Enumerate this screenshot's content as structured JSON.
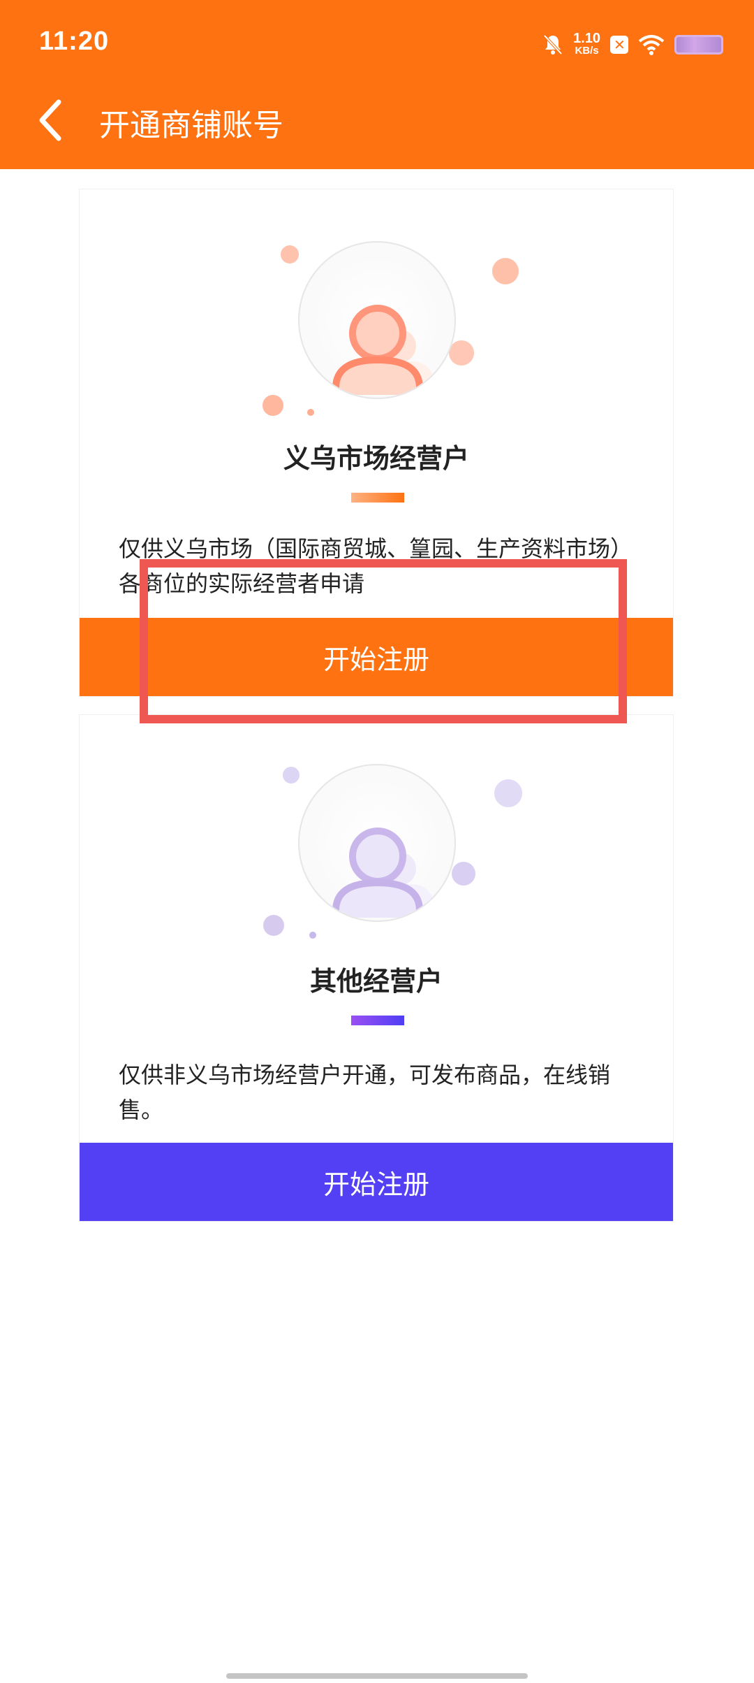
{
  "status_bar": {
    "time": "11:20",
    "net_speed_value": "1.10",
    "net_speed_unit": "KB/s",
    "icons": [
      "bell-off-icon",
      "x-icon",
      "wifi-icon",
      "battery-icon"
    ]
  },
  "header": {
    "title": "开通商铺账号",
    "back_icon": "chevron-left-icon"
  },
  "cards": [
    {
      "title": "义乌市场经营户",
      "description": "仅供义乌市场（国际商贸城、篁园、生产资料市场）各商位的实际经营者申请",
      "button_label": "开始注册",
      "accent_color": "#ff7212"
    },
    {
      "title": "其他经营户",
      "description": "仅供非义乌市场经营户开通，可发布商品，在线销售。",
      "button_label": "开始注册",
      "accent_color": "#533ff4"
    }
  ],
  "colors": {
    "header_bg": "#ff7212",
    "primary_button": "#ff7212",
    "secondary_button": "#533ff4",
    "highlight_box": "#ef5753"
  }
}
